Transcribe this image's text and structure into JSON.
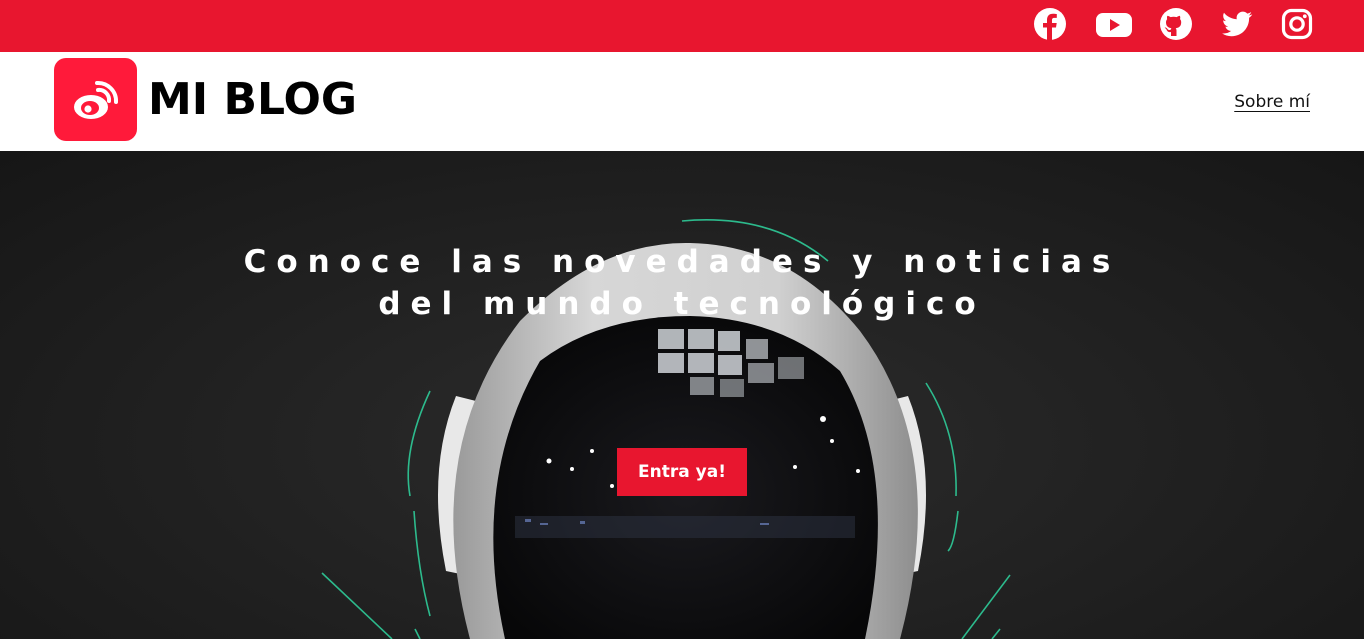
{
  "topbar": {
    "social": [
      {
        "icon": "facebook-icon"
      },
      {
        "icon": "youtube-icon"
      },
      {
        "icon": "github-icon"
      },
      {
        "icon": "twitter-icon"
      },
      {
        "icon": "instagram-icon"
      }
    ]
  },
  "header": {
    "brand": "MI BLOG",
    "logo_icon": "weibo-icon",
    "nav": {
      "about": "Sobre mí"
    }
  },
  "hero": {
    "title_line1": "Conoce las novedades y noticias",
    "title_line2": "del mundo tecnológico",
    "cta": "Entra ya!",
    "background": "astronaut-helmet-photo"
  },
  "colors": {
    "brand_red": "#e8162f",
    "logo_red": "#ff1a3a",
    "hero_dark": "#222222",
    "accent_teal": "#2fd6a0",
    "text_white": "#ffffff"
  }
}
